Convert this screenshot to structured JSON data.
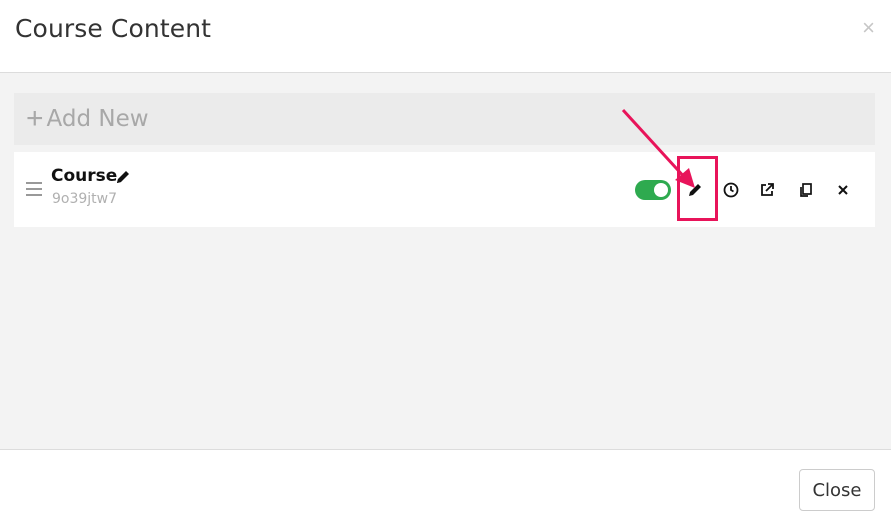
{
  "header": {
    "title": "Course Content",
    "close_symbol": "×"
  },
  "body": {
    "add_new": {
      "plus_symbol": "+",
      "label": "Add New"
    },
    "items": [
      {
        "title": "Course",
        "code": "9o39jtw7",
        "published": true
      }
    ]
  },
  "footer": {
    "close_label": "Close"
  },
  "colors": {
    "toggle_on": "#2eaa4f",
    "highlight": "#e8145a"
  },
  "icons": [
    "drag-handle-icon",
    "pencil-icon",
    "clock-icon",
    "external-link-icon",
    "copy-icon",
    "close-icon",
    "plus-icon"
  ]
}
